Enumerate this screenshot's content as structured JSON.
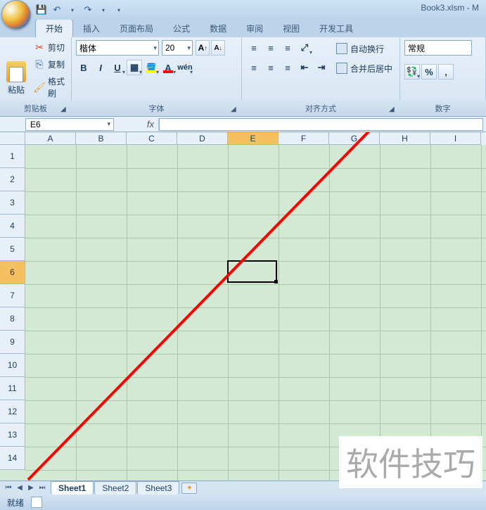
{
  "title": "Book3.xlsm - M",
  "tabs": [
    "开始",
    "插入",
    "页面布局",
    "公式",
    "数据",
    "审阅",
    "视图",
    "开发工具"
  ],
  "active_tab": 0,
  "clipboard": {
    "paste": "粘贴",
    "cut": "剪切",
    "copy": "复制",
    "brush": "格式刷",
    "group": "剪贴板"
  },
  "font": {
    "name": "楷体",
    "size": "20",
    "grow": "A",
    "shrink": "A",
    "bold": "B",
    "italic": "I",
    "underline": "U",
    "fill": "A",
    "color": "A",
    "wen": "wén",
    "group": "字体"
  },
  "align": {
    "wrap": "自动换行",
    "merge": "合并后居中",
    "group": "对齐方式"
  },
  "number": {
    "format": "常规",
    "percent": "%",
    "comma": ",",
    "group": "数字"
  },
  "name_box": "E6",
  "fx": "fx",
  "formula": "",
  "columns": [
    "A",
    "B",
    "C",
    "D",
    "E",
    "F",
    "G",
    "H",
    "I"
  ],
  "rows": [
    "1",
    "2",
    "3",
    "4",
    "5",
    "6",
    "7",
    "8",
    "9",
    "10",
    "11",
    "12",
    "13",
    "14"
  ],
  "selected_col": "E",
  "selected_row": "6",
  "sheets": [
    "Sheet1",
    "Sheet2",
    "Sheet3"
  ],
  "active_sheet": 0,
  "status": "就绪",
  "watermark": "软件技巧"
}
